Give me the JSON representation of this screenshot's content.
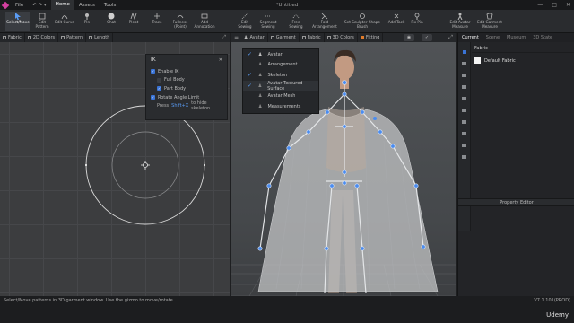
{
  "menubar": {
    "items": [
      "File",
      "Home",
      "Assets",
      "Tools"
    ],
    "active": "Home",
    "title": "*Untitled",
    "window_controls": [
      "—",
      "□",
      "✕"
    ]
  },
  "toolbar": {
    "tools": [
      {
        "label": "Select/Move",
        "icon": "cursor-icon"
      },
      {
        "label": "Edit Pattern",
        "icon": "edit-pattern-icon"
      },
      {
        "label": "Edit Curve",
        "icon": "curve-icon"
      },
      {
        "label": "Pin",
        "icon": "pin-icon"
      },
      {
        "label": "Chat",
        "icon": "chat-icon"
      },
      {
        "label": "Pleat",
        "icon": "pleat-icon"
      },
      {
        "label": "Trace",
        "icon": "trace-icon"
      },
      {
        "label": "Fullness (Point)",
        "icon": "fullness-icon"
      },
      {
        "label": "Add Annotation",
        "icon": "annotation-icon"
      },
      {
        "label": "Edit Sewing",
        "icon": "sewing-icon"
      },
      {
        "label": "Segment Sewing",
        "icon": "segment-sewing-icon"
      },
      {
        "label": "Free Sewing",
        "icon": "free-sewing-icon"
      },
      {
        "label": "Fold Arrangement",
        "icon": "fold-icon"
      },
      {
        "label": "Set Sculpter Shape Brush",
        "icon": "brush-icon"
      },
      {
        "label": "Add Tack",
        "icon": "tack-icon"
      },
      {
        "label": "Fix Pin",
        "icon": "fix-pin-icon"
      },
      {
        "label": "Edit Avatar Measure",
        "icon": "avatar-measure-icon"
      },
      {
        "label": "Edit Garment Measure",
        "icon": "garment-measure-icon"
      }
    ]
  },
  "panel2d": {
    "tabs": [
      "Fabric",
      "2D Colors",
      "Pattern",
      "Length"
    ]
  },
  "panel3d": {
    "tabs": [
      "Avatar",
      "Garment",
      "Fabric",
      "3D Colors",
      "Fitting"
    ]
  },
  "ik_dialog": {
    "title": "IK",
    "close": "✕",
    "enable_ik": "Enable IK",
    "full_body": "Full Body",
    "part_body": "Part Body",
    "rotate_angle_limit": "Rotate Angle Limit",
    "hint_prefix": "Press",
    "hint_key": "Shift+X",
    "hint_suffix": "to hide skeleton"
  },
  "avatar_menu": {
    "items": [
      {
        "label": "Avatar",
        "checked": true
      },
      {
        "label": "Arrangement",
        "checked": false
      },
      {
        "label": "Skeleton",
        "checked": true
      },
      {
        "label": "Avatar Textured Surface",
        "checked": true
      },
      {
        "label": "Avatar Mesh",
        "checked": false
      },
      {
        "label": "Measurements",
        "checked": false
      }
    ]
  },
  "right_panel": {
    "tabs": [
      "Current",
      "Scene",
      "Museum",
      "3D State"
    ],
    "active_tab": "Current",
    "section": "Fabric",
    "fabric_item": "Default Fabric",
    "property_editor": "Property Editor"
  },
  "status": {
    "message": "Select/Move patterns in 3D garment window. Use the gizmo to move/rotate.",
    "version": "V7.1.101(PROD)",
    "watermark": "Udemy"
  },
  "colors": {
    "accent": "#3a74d6",
    "joint": "#4a8cf0",
    "logo": "#d33fa0"
  }
}
